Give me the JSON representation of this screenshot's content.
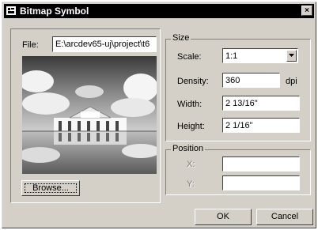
{
  "window": {
    "title": "Bitmap Symbol",
    "close_glyph": "×"
  },
  "file": {
    "label": "File:",
    "value": "E:\\arcdev65-uj\\project\\t6"
  },
  "preview": {
    "description_icon": "bitmap-preview-image"
  },
  "browse": {
    "label": "Browse..."
  },
  "size": {
    "legend": "Size",
    "scale_label": "Scale:",
    "scale_value": "1:1",
    "density_label": "Density:",
    "density_value": "360",
    "density_unit": "dpi",
    "width_label": "Width:",
    "width_value": "2 13/16\"",
    "height_label": "Height:",
    "height_value": "2 1/16\""
  },
  "position": {
    "legend": "Position",
    "x_label": "X:",
    "y_label": "Y:",
    "x_value": "",
    "y_value": ""
  },
  "buttons": {
    "ok": "OK",
    "cancel": "Cancel"
  },
  "colors": {
    "titlebar": "#000000",
    "face": "#d4d0c8"
  }
}
